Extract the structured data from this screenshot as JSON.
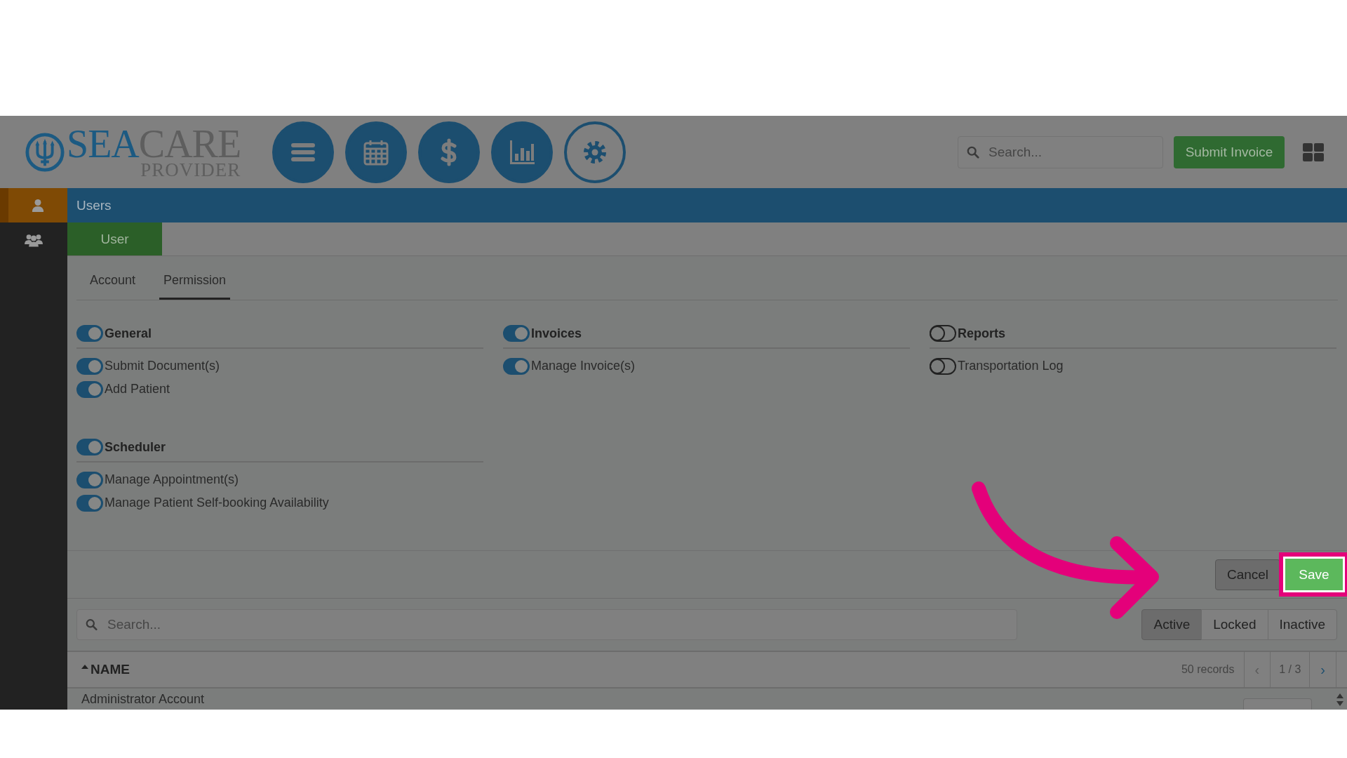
{
  "header": {
    "logo": {
      "name_primary": "SEA",
      "name_secondary": "CARE",
      "tagline": "PROVIDER"
    },
    "nav_buttons": [
      {
        "kind": "menu",
        "selected": false
      },
      {
        "kind": "calendar",
        "selected": false
      },
      {
        "kind": "dollar",
        "selected": false
      },
      {
        "kind": "chart",
        "selected": false
      },
      {
        "kind": "gear",
        "selected": true
      }
    ],
    "search": {
      "placeholder": "Search..."
    },
    "submit_button": "Submit Invoice"
  },
  "sidebar": {
    "items": [
      {
        "kind": "user",
        "selected": true
      },
      {
        "kind": "users",
        "selected": false
      }
    ]
  },
  "page_title": "Users",
  "record_tabs": [
    {
      "label": "User",
      "selected": true
    }
  ],
  "tabs": [
    {
      "label": "Account",
      "selected": false
    },
    {
      "label": "Permission",
      "selected": true
    }
  ],
  "permission_columns": [
    [
      {
        "label": "General",
        "on": true,
        "items": [
          {
            "label": "Submit Document(s)",
            "on": true
          },
          {
            "label": "Add Patient",
            "on": true
          }
        ]
      },
      {
        "label": "Scheduler",
        "on": true,
        "items": [
          {
            "label": "Manage Appointment(s)",
            "on": true
          },
          {
            "label": "Manage Patient Self-booking Availability",
            "on": true
          }
        ]
      }
    ],
    [
      {
        "label": "Invoices",
        "on": true,
        "items": [
          {
            "label": "Manage Invoice(s)",
            "on": true
          }
        ]
      }
    ],
    [
      {
        "label": "Reports",
        "on": false,
        "items": [
          {
            "label": "Transportation Log",
            "on": false
          }
        ]
      }
    ]
  ],
  "form_buttons": [
    {
      "label": "Cancel",
      "kind": "secondary",
      "highlighted": false
    },
    {
      "label": "Save",
      "kind": "primary",
      "highlighted": true
    }
  ],
  "annotation": {
    "kind": "arrow"
  },
  "list": {
    "search": {
      "placeholder": "Search..."
    },
    "filters": [
      {
        "label": "Active",
        "selected": true
      },
      {
        "label": "Locked",
        "selected": false
      },
      {
        "label": "Inactive",
        "selected": false
      }
    ],
    "sort_column": "NAME",
    "sort_ascending": true,
    "records": "50 records",
    "prev": {
      "label": "‹",
      "disabled": true
    },
    "page": "1 / 3",
    "next": {
      "label": "›",
      "disabled": false
    },
    "rows": [
      {
        "name": "Administrator Account"
      }
    ]
  }
}
